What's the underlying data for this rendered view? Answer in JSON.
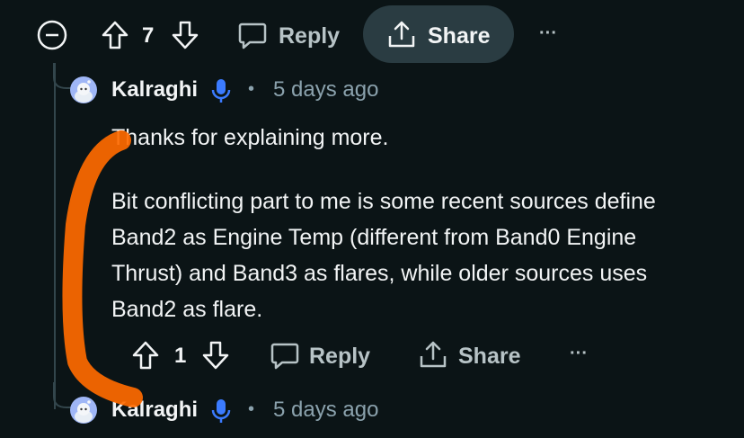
{
  "top_bar": {
    "vote_count": "7",
    "reply_label": "Reply",
    "share_label": "Share",
    "more_label": "···"
  },
  "comment": {
    "username": "Kalraghi",
    "separator": "•",
    "timestamp": "5 days ago",
    "paragraph_1": "Thanks for explaining more.",
    "paragraph_2": "Bit conflicting part to me is some recent sources define Band2 as Engine Temp (different from Band0 Engine Thrust) and Band3 as flares, while older sources uses Band2 as flare.",
    "vote_count": "1",
    "reply_label": "Reply",
    "share_label": "Share",
    "more_label": "···"
  },
  "next_comment": {
    "username": "Kalraghi",
    "separator": "•",
    "timestamp": "5 days ago"
  },
  "colors": {
    "background": "#0b1416",
    "muted_text": "#8ba2ad",
    "action_text": "#b7c3c6",
    "pill_bg": "#2a3c42",
    "mic_blue": "#3b7bff",
    "annotation_orange": "#ff6a00"
  }
}
